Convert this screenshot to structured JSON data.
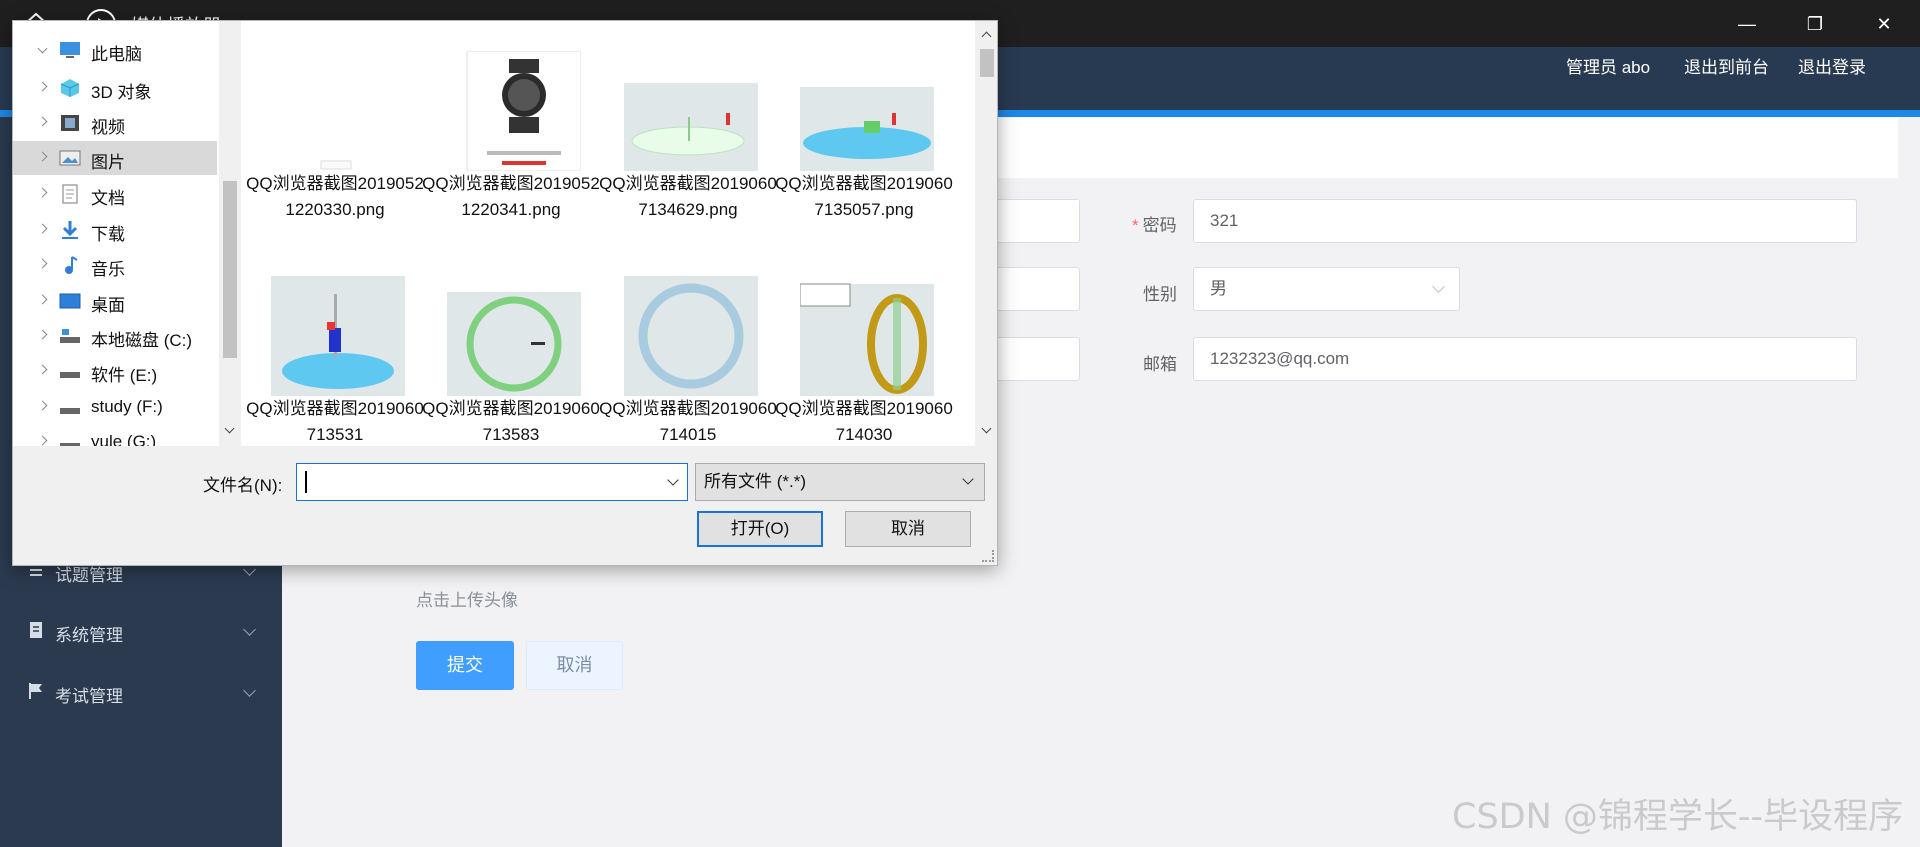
{
  "player": {
    "title": "媒体播放器",
    "icons": [
      "home-icon",
      "play-icon",
      "minimize-icon",
      "restore-icon",
      "close-icon"
    ]
  },
  "header": {
    "admin_label": "管理员 abo",
    "front_link": "退出到前台",
    "logout_link": "退出登录"
  },
  "sidebar": {
    "items": [
      {
        "label": "试题管理",
        "icon": "list-icon"
      },
      {
        "label": "系统管理",
        "icon": "document-icon"
      },
      {
        "label": "考试管理",
        "icon": "flag-icon"
      }
    ]
  },
  "form": {
    "password_label": "密码",
    "password_value": "321",
    "gender_label": "性别",
    "gender_value": "男",
    "email_label": "邮箱",
    "email_value": "1232323@qq.com",
    "upload_hint": "点击上传头像",
    "submit_label": "提交",
    "cancel_label": "取消"
  },
  "dialog": {
    "tree": [
      {
        "label": "此电脑",
        "icon": "computer-icon"
      },
      {
        "label": "3D 对象",
        "icon": "cube-icon"
      },
      {
        "label": "视频",
        "icon": "video-icon"
      },
      {
        "label": "图片",
        "icon": "pictures-icon",
        "selected": true
      },
      {
        "label": "文档",
        "icon": "document-icon"
      },
      {
        "label": "下载",
        "icon": "download-icon"
      },
      {
        "label": "音乐",
        "icon": "music-icon"
      },
      {
        "label": "桌面",
        "icon": "desktop-icon"
      },
      {
        "label": "本地磁盘 (C:)",
        "icon": "drive-icon"
      },
      {
        "label": "软件 (E:)",
        "icon": "drive-icon"
      },
      {
        "label": "study (F:)",
        "icon": "drive-icon"
      },
      {
        "label": "yule (G:)",
        "icon": "drive-icon"
      }
    ],
    "files": [
      {
        "name": "QQ浏览器截图20190521220330.png"
      },
      {
        "name": "QQ浏览器截图20190521220341.png"
      },
      {
        "name": "QQ浏览器截图20190607134629.png"
      },
      {
        "name": "QQ浏览器截图20190607135057.png"
      },
      {
        "name": "QQ浏览器截图2019060713531"
      },
      {
        "name": "QQ浏览器截图2019060713583"
      },
      {
        "name": "QQ浏览器截图2019060714015"
      },
      {
        "name": "QQ浏览器截图2019060714030"
      }
    ],
    "filename_label": "文件名(N):",
    "filename_value": "",
    "filetype_value": "所有文件 (*.*)",
    "open_label": "打开(O)",
    "cancel_label": "取消"
  },
  "watermark": "CSDN @锦程学长--毕设程序"
}
